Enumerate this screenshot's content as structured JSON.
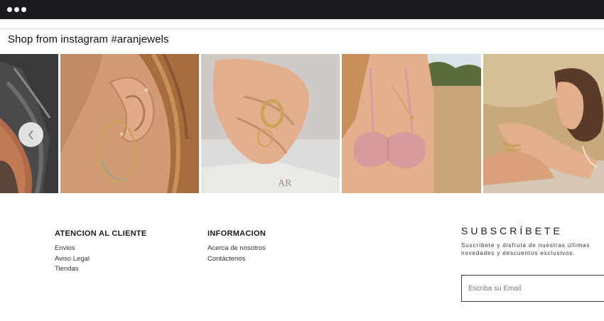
{
  "browser": {
    "menu_icon": "three-dots-icon"
  },
  "instagram": {
    "title": "Shop from instagram #aranjewels",
    "prev_icon": "chevron-left-icon",
    "box_text": "AR",
    "posts": [
      {
        "subject": "arm on dark fabric"
      },
      {
        "subject": "ear with hoop earring"
      },
      {
        "subject": "hand with rings"
      },
      {
        "subject": "pink bikini in wheat field"
      },
      {
        "subject": "woman in wheat field with bracelets"
      }
    ]
  },
  "footer": {
    "customer_service": {
      "heading": "ATENCION AL CLIENTE",
      "links": [
        "Envios",
        "Aviso Legal",
        "Tiendas"
      ]
    },
    "information": {
      "heading": "INFORMACION",
      "links": [
        "Acerca de nosotros",
        "Contáctenos"
      ]
    },
    "newsletter": {
      "heading": "SUBSCRÍBETE",
      "text_line1": "Suscríbete y disfruta de nuestras últimas",
      "text_line2": "novedades y descuentos exclusivos.",
      "email_placeholder": "Escriba su Email"
    }
  },
  "colors": {
    "topbar": "#1b1c20",
    "skin": "#d9a07a",
    "wheat": "#c9a97a",
    "bikini": "#d99a9c",
    "gold": "#c9a45a"
  }
}
